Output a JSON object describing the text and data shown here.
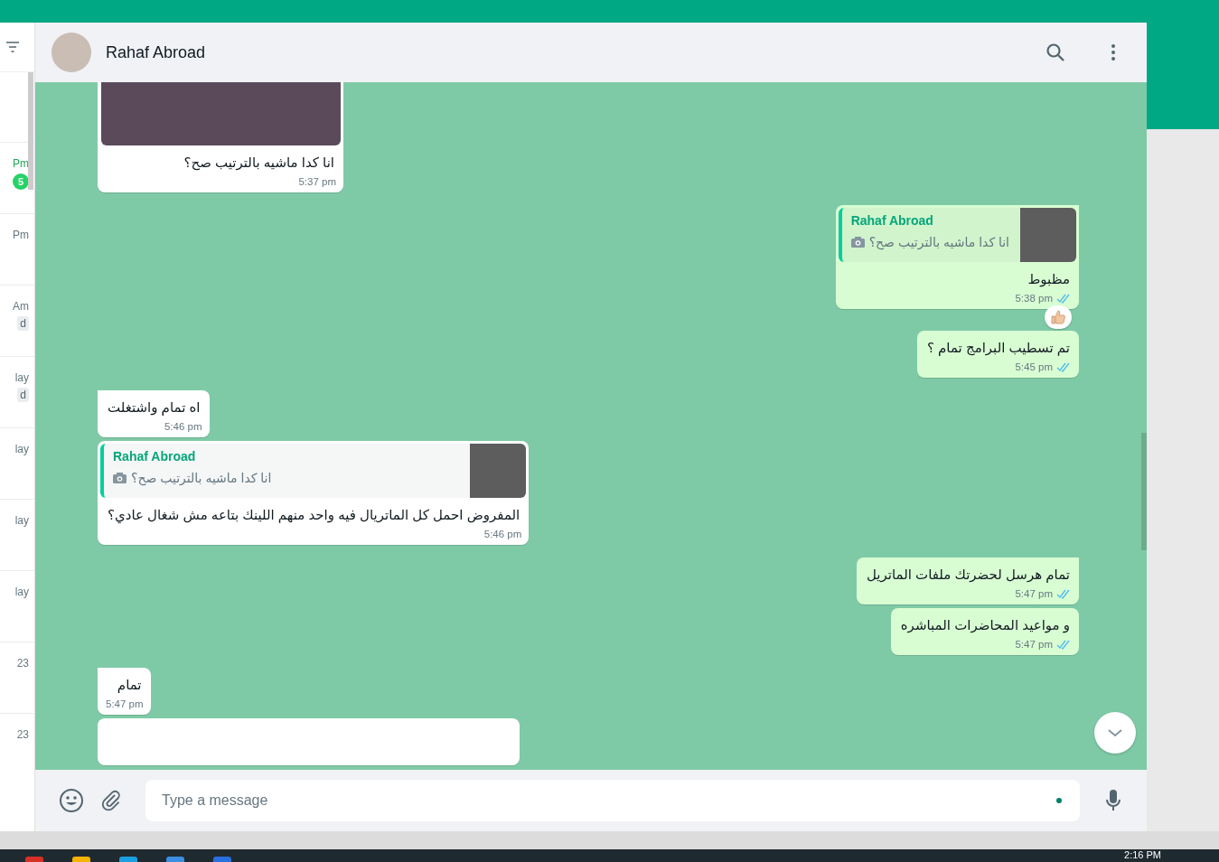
{
  "sidebar": {
    "rows": [
      {
        "time": "Pm",
        "unread": "5"
      },
      {
        "time": "Pm"
      },
      {
        "time": "Am",
        "badge": "d"
      },
      {
        "time": "lay",
        "badge": "d"
      },
      {
        "time": "lay"
      },
      {
        "time": "lay"
      },
      {
        "time": "lay"
      },
      {
        "time": "23"
      },
      {
        "time": "23"
      }
    ]
  },
  "chat": {
    "title": "Rahaf Abroad",
    "messages": [
      {
        "kind": "photo",
        "outgoing": false,
        "text": "انا كدا ماشيه بالترتيب صح؟",
        "time": "5:37 pm"
      },
      {
        "kind": "reply",
        "outgoing": true,
        "reply": {
          "author": "Rahaf Abroad",
          "text": "انا كدا ماشيه بالترتيب صح؟"
        },
        "text": "مظبوط",
        "time": "5:38 pm",
        "read": true,
        "reacted": true
      },
      {
        "kind": "text",
        "outgoing": true,
        "text": "تم تسطيب البرامج تمام ؟",
        "time": "5:45 pm",
        "read": true
      },
      {
        "kind": "text",
        "outgoing": false,
        "text": "اه تمام واشتغلت",
        "time": "5:46 pm"
      },
      {
        "kind": "reply",
        "outgoing": false,
        "reply": {
          "author": "Rahaf Abroad",
          "text": "انا كدا ماشيه بالترتيب صح؟"
        },
        "text": "المفروض احمل كل الماتريال فيه واحد منهم اللينك بتاعه مش شغال عادي؟",
        "time": "5:46 pm"
      },
      {
        "kind": "text",
        "outgoing": true,
        "text": "تمام هرسل لحضرتك ملفات الماتريل",
        "time": "5:47 pm",
        "read": true
      },
      {
        "kind": "text",
        "outgoing": true,
        "text": "و مواعيد المحاضرات المباشره",
        "time": "5:47 pm",
        "read": true
      },
      {
        "kind": "text",
        "outgoing": false,
        "text": "تمام",
        "time": "5:47 pm"
      },
      {
        "kind": "cut",
        "outgoing": false
      }
    ],
    "composer": {
      "placeholder": "Type a message"
    }
  },
  "taskbar": {
    "clock": "2:16 PM"
  }
}
